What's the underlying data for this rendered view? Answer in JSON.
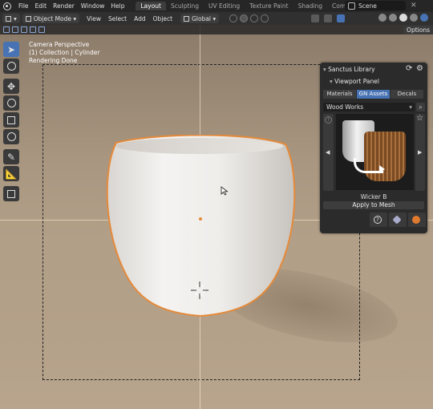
{
  "topbar": {
    "menu": [
      "File",
      "Edit",
      "Render",
      "Window",
      "Help"
    ],
    "workspaces": [
      "Layout",
      "Sculpting",
      "UV Editing",
      "Texture Paint",
      "Shading",
      "Compositing"
    ],
    "active_workspace": "Layout",
    "scene_label": "Scene"
  },
  "header": {
    "mode": "Object Mode",
    "menus": [
      "View",
      "Select",
      "Add",
      "Object"
    ],
    "orientation": "Global"
  },
  "viewport": {
    "options_label": "Options",
    "overlay_lines": [
      "Camera Perspective",
      "(1) Collection | Cylinder",
      "Rendering Done"
    ]
  },
  "panel": {
    "title": "Sanctus Library",
    "subpanel": "Viewport Panel",
    "tabs": [
      "Materials",
      "GN Assets",
      "Decals"
    ],
    "active_tab": "GN Assets",
    "category": "Wood Works",
    "asset_name": "Wicker B",
    "apply_label": "Apply to Mesh",
    "prev_icon": "◀",
    "next_icon": "▶",
    "help_icon": "?",
    "star_icon": "☆",
    "search_icon": "⌕"
  },
  "colors": {
    "accent": "#4772b3",
    "selection_outline": "#e58a3a",
    "topbar_bg": "#262626",
    "header_bg": "#303030"
  }
}
